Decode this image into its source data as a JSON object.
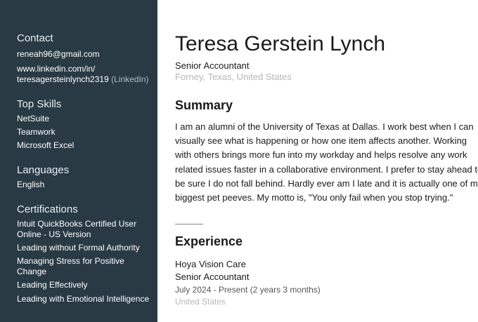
{
  "sidebar": {
    "contact_heading": "Contact",
    "email": "reneah96@gmail.com",
    "linkedin_url_line1": "www.linkedin.com/in/",
    "linkedin_url_line2": "teresagersteinlynch2319",
    "linkedin_label": "(LinkedIn)",
    "skills_heading": "Top Skills",
    "skills": [
      "NetSuite",
      "Teamwork",
      "Microsoft Excel"
    ],
    "languages_heading": "Languages",
    "languages": [
      "English"
    ],
    "certifications_heading": "Certifications",
    "certifications": [
      "Intuit QuickBooks Certified User Online - US Version",
      "Leading without Formal Authority",
      "Managing Stress for Positive Change",
      "Leading Effectively",
      "Leading with Emotional Intelligence"
    ]
  },
  "profile": {
    "name": "Teresa Gerstein Lynch",
    "title": "Senior Accountant",
    "location": "Forney, Texas, United States"
  },
  "summary": {
    "heading": "Summary",
    "text": "I am an alumni of the University of Texas at Dallas. I work best when I can visually see what is happening or how one item affects another. Working with others brings more fun into my workday and helps resolve any work related issues faster in a collaborative environment. I prefer to stay ahead to be sure I do not fall behind. Hardly ever am I late and it is actually one of my biggest pet peeves. My motto is, \"You only fail when you stop trying.\""
  },
  "experience": {
    "heading": "Experience",
    "company": "Hoya Vision Care",
    "role": "Senior Accountant",
    "dates": "July 2024 - Present (2 years 3 months)",
    "location": "United States"
  },
  "colors": {
    "sidebar_bg": "#293a45",
    "muted_text": "#b7b7b7"
  }
}
